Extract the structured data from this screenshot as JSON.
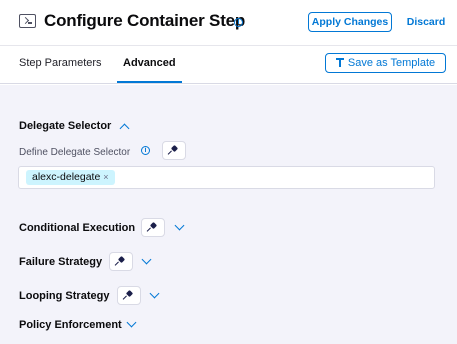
{
  "header": {
    "title": "Configure Container Step",
    "apply_label": "Apply Changes",
    "discard_label": "Discard"
  },
  "tabs": [
    {
      "label": "Step Parameters",
      "active": false
    },
    {
      "label": "Advanced",
      "active": true
    }
  ],
  "toolbar": {
    "save_template_label": "Save as Template"
  },
  "delegate": {
    "section_label": "Delegate Selector",
    "field_label": "Define Delegate Selector",
    "tags": [
      {
        "label": "alexc-delegate",
        "remove_icon": "×"
      }
    ]
  },
  "sections": {
    "conditional": "Conditional Execution",
    "failure": "Failure Strategy",
    "looping": "Looping Strategy",
    "policy": "Policy Enforcement"
  },
  "icons": {
    "step": "terminal-icon",
    "info": "info-icon",
    "pin": "pin-icon",
    "template": "template-icon"
  },
  "colors": {
    "accent": "#0278d5",
    "background": "#f3f3fa",
    "tag_bg": "#cdf4fe",
    "text": "#0b0b0d"
  }
}
